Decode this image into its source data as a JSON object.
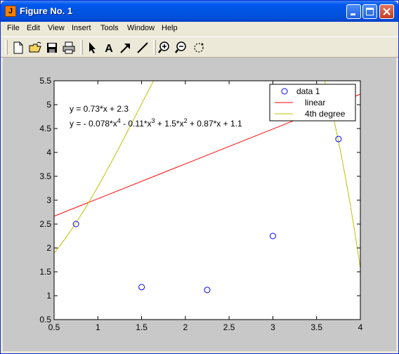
{
  "window": {
    "title": "Figure No. 1",
    "app_icon_glyph": "J"
  },
  "menubar": {
    "items": [
      "File",
      "Edit",
      "View",
      "Insert",
      "Tools",
      "Window",
      "Help"
    ]
  },
  "toolbar": {
    "tools": [
      "new-file-icon",
      "open-folder-icon",
      "save-icon",
      "print-icon",
      "select-arrow-icon",
      "insert-text-icon",
      "insert-arrow-icon",
      "insert-line-icon",
      "zoom-in-icon",
      "zoom-out-icon",
      "rotate-3d-icon"
    ],
    "insert_text_glyph": "A"
  },
  "colors": {
    "data_marker": "#0000ff",
    "linear": "#ff0000",
    "quartic": "#c0c000",
    "figure_bg": "#c8c8c8",
    "axes_bg": "#ffffff"
  },
  "chart_data": {
    "type": "scatter",
    "xlim": [
      0.5,
      4
    ],
    "ylim": [
      0.5,
      5.5
    ],
    "xticks": [
      "0.5",
      "1",
      "1.5",
      "2",
      "2.5",
      "3",
      "3.5",
      "4"
    ],
    "yticks": [
      "0.5",
      "1",
      "1.5",
      "2",
      "2.5",
      "3",
      "3.5",
      "4",
      "4.5",
      "5",
      "5.5"
    ],
    "grid": false,
    "legend_position": "top-right",
    "series": [
      {
        "name": "data 1",
        "kind": "markers",
        "marker": "circle",
        "x": [
          0.75,
          1.5,
          2.25,
          3.0,
          3.75
        ],
        "y": [
          2.5,
          1.18,
          1.12,
          2.25,
          4.28
        ]
      },
      {
        "name": "linear",
        "kind": "line",
        "slope": 0.73,
        "intercept": 2.3
      },
      {
        "name": "4th degree",
        "kind": "line",
        "coefficients": [
          -0.078,
          -0.11,
          1.5,
          0.87,
          1.1
        ]
      }
    ],
    "annotations": {
      "linear_eq": "y = 0.73*x + 2.3",
      "quartic_eq": {
        "p1": "y = - 0.078*x",
        "e1": "4",
        "p2": " - 0.11*x",
        "e2": "3",
        "p3": " + 1.5*x",
        "e3": "2",
        "p4": " + 0.87*x + 1.1"
      }
    }
  }
}
